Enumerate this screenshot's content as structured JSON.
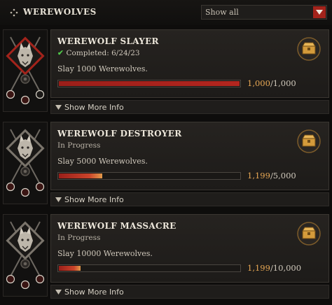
{
  "header": {
    "title": "WEREWOLVES",
    "filter": {
      "selected": "Show all"
    }
  },
  "achievements": [
    {
      "title": "WEREWOLF SLAYER",
      "status": "Completed: 6/24/23",
      "completed": true,
      "description": "Slay 1000 Werewolves.",
      "current": "1,000",
      "total": "/1,000",
      "progress_fraction": 1.0,
      "more_label": "Show More Info"
    },
    {
      "title": "WEREWOLF DESTROYER",
      "status": "In Progress",
      "completed": false,
      "description": "Slay 5000 Werewolves.",
      "current": "1,199",
      "total": "/5,000",
      "progress_fraction": 0.24,
      "more_label": "Show More Info"
    },
    {
      "title": "WEREWOLF MASSACRE",
      "status": "In Progress",
      "completed": false,
      "description": "Slay 10000 Werewolves.",
      "current": "1,199",
      "total": "/10,000",
      "progress_fraction": 0.12,
      "more_label": "Show More Info"
    }
  ],
  "colors": {
    "accent_red": "#a3231b",
    "progress_red": "#9b1f1a",
    "count_gold": "#e9a955",
    "check_green": "#4fc74a"
  },
  "icons": {
    "header": "diamond-dots-icon",
    "reward": "chest-icon",
    "badge": "wolf-crest-icon",
    "expand": "triangle-down-icon"
  }
}
